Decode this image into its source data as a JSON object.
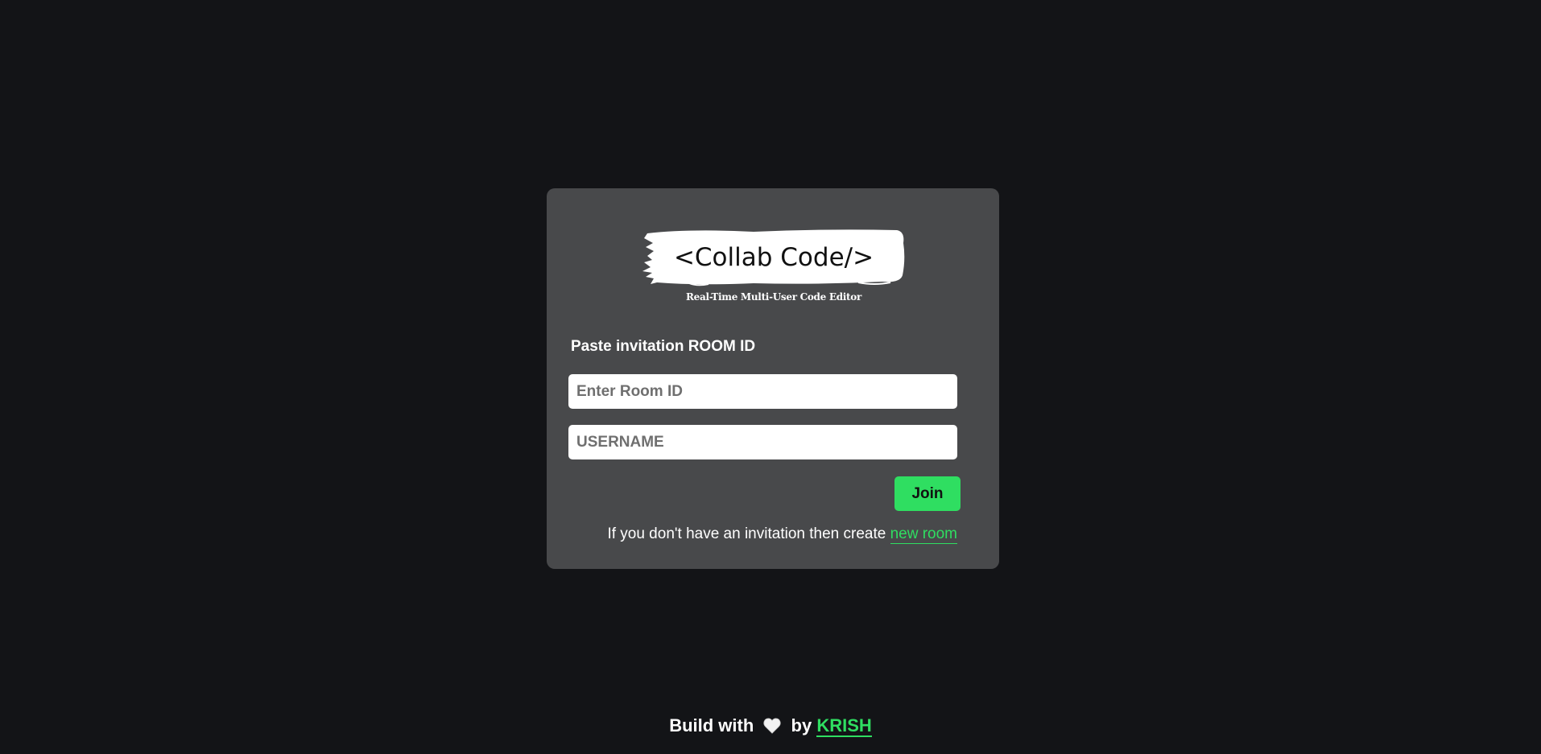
{
  "logo": {
    "title": "<Collab Code/>",
    "subtitle": "Real-Time Multi-User Code Editor"
  },
  "form": {
    "label": "Paste invitation ROOM ID",
    "room_placeholder": "Enter Room ID",
    "room_value": "",
    "username_placeholder": "USERNAME",
    "username_value": "",
    "join_label": "Join",
    "info_text": "If you don't have an invitation then create ",
    "new_room_link": "new room"
  },
  "footer": {
    "prefix": "Build with",
    "heart_icon": "white-heart-icon",
    "middle": "by",
    "author_link": "KRISH"
  },
  "colors": {
    "background": "#131417",
    "card": "#48494b",
    "accent": "#2fde61"
  }
}
